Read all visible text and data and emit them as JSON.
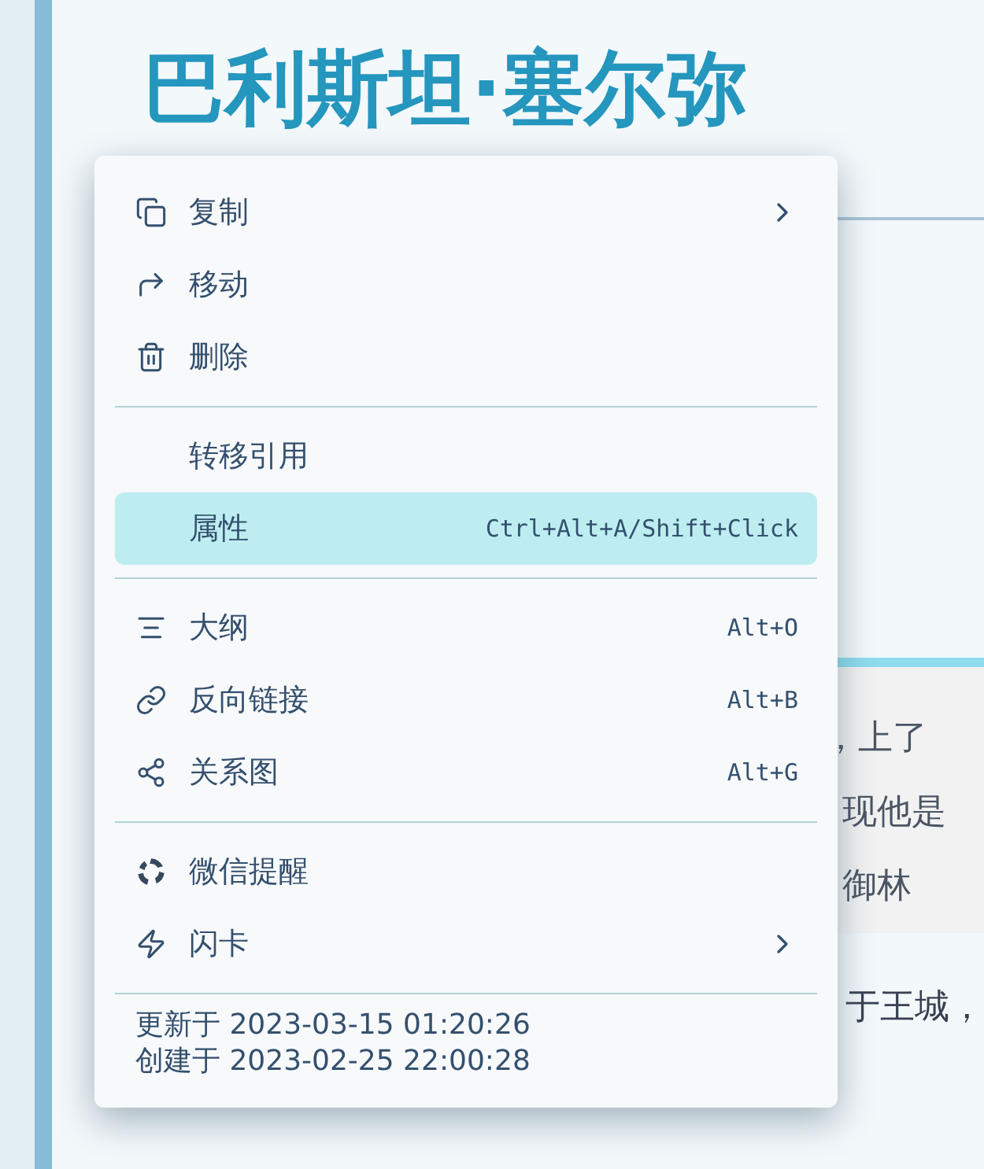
{
  "document": {
    "title": "巴利斯坦·塞尔弥",
    "card_lines": [
      "，上了",
      "现他是",
      "御林"
    ],
    "after_card": "于王城，"
  },
  "menu": {
    "sections": [
      [
        {
          "label": "复制",
          "has_submenu": true,
          "selected": false
        },
        {
          "label": "移动",
          "has_submenu": false,
          "selected": false
        },
        {
          "label": "删除",
          "has_submenu": false,
          "selected": false
        }
      ],
      [
        {
          "label": "转移引用",
          "has_submenu": false,
          "selected": false
        },
        {
          "label": "属性",
          "shortcut": "Ctrl+Alt+A/Shift+Click",
          "has_submenu": false,
          "selected": true
        }
      ],
      [
        {
          "label": "大纲",
          "shortcut": "Alt+O",
          "has_submenu": false,
          "selected": false
        },
        {
          "label": "反向链接",
          "shortcut": "Alt+B",
          "has_submenu": false,
          "selected": false
        },
        {
          "label": "关系图",
          "shortcut": "Alt+G",
          "has_submenu": false,
          "selected": false
        }
      ],
      [
        {
          "label": "微信提醒",
          "has_submenu": false,
          "selected": false
        },
        {
          "label": "闪卡",
          "has_submenu": true,
          "selected": false
        }
      ]
    ],
    "footer": [
      "更新于 2023-03-15 01:20:26",
      "创建于 2023-02-25 22:00:28"
    ]
  }
}
